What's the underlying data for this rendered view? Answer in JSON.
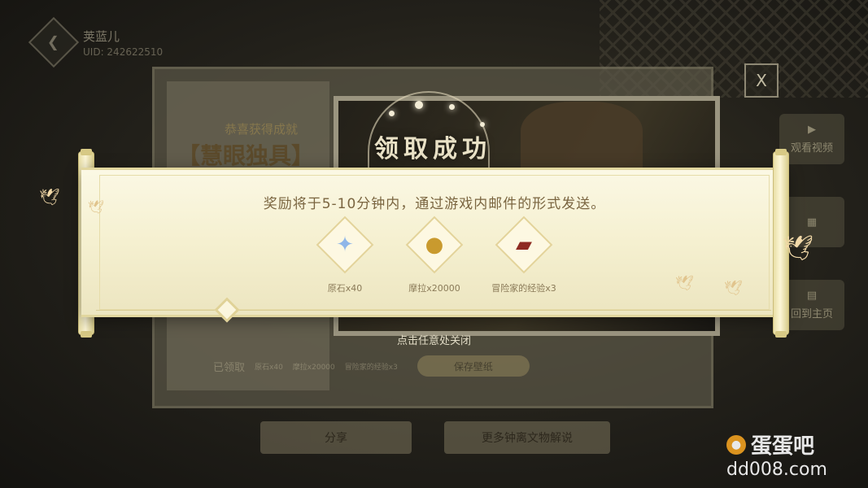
{
  "player": {
    "name": "荚蓝儿",
    "uid": "UID: 242622510",
    "avatar_icon": "back-arrow-icon"
  },
  "achievement": {
    "congrats": "恭喜获得成就",
    "name": "【慧眼独具】"
  },
  "popup": {
    "title": "领取成功",
    "message": "奖励将于5-10分钟内，通过游戏内邮件的形式发送。",
    "rewards": [
      {
        "icon": "primogem-icon",
        "label": "原石x40"
      },
      {
        "icon": "mora-icon",
        "label": "摩拉x20000"
      },
      {
        "icon": "adventurer-exp-icon",
        "label": "冒险家的经验x3"
      }
    ],
    "hint": "点击任意处关闭"
  },
  "close_button": {
    "label": "X"
  },
  "claimed_bar": {
    "label": "已领取",
    "items": [
      "原石x40",
      "摩拉x20000",
      "冒险家的经验x3"
    ],
    "save_button": "保存壁纸"
  },
  "side_buttons": [
    {
      "icon": "play-icon",
      "label": "观看视频"
    },
    {
      "icon": "gallery-icon",
      "label": ""
    },
    {
      "icon": "archive-icon",
      "label": "回到主页"
    }
  ],
  "bottom_buttons": {
    "share": "分享",
    "more": "更多钟离文物解说"
  },
  "watermark": {
    "title": "蛋蛋吧",
    "url": "dd008.com"
  },
  "colors": {
    "scroll_bg": "#f5f0d0",
    "scroll_border": "#e1d69e",
    "message_text": "#7a6540",
    "title_text": "#e9e1c6",
    "overlay_bg": "#1b1a15"
  }
}
